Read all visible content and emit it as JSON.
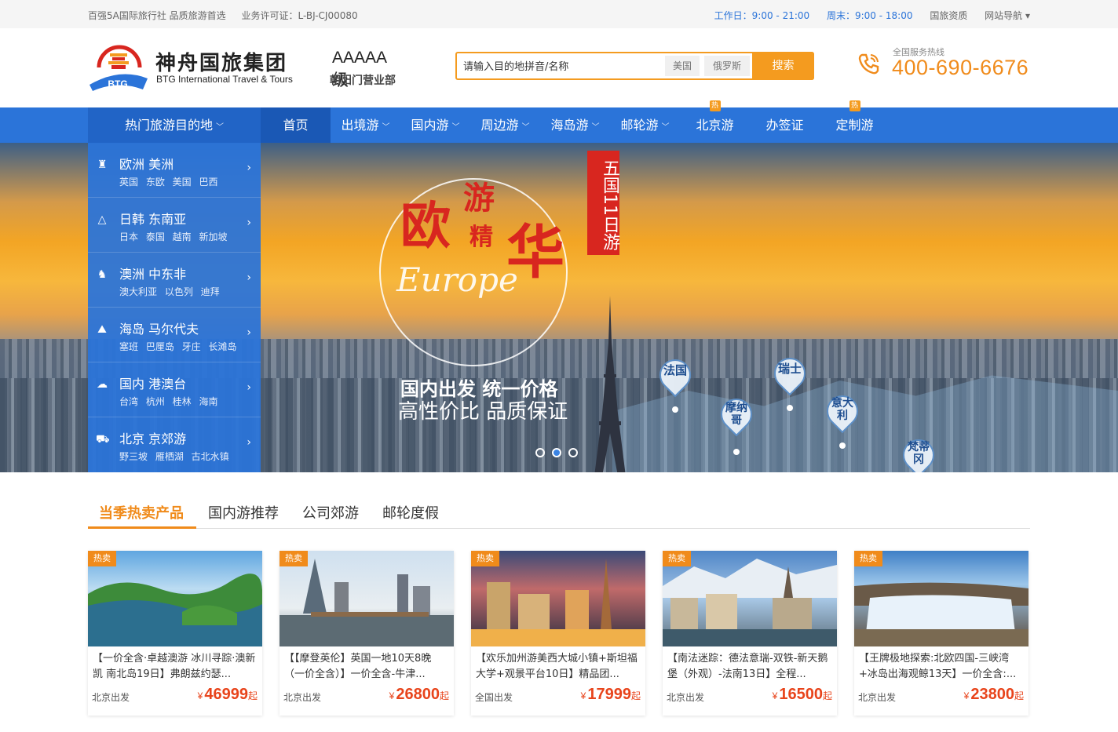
{
  "topbar": {
    "slogan": "百强5A国际旅行社 品质旅游首选",
    "license": "业务许可证：L-BJ-CJ00080",
    "workday": "工作日：9:00 - 21:00",
    "weekend": "周末：9:00 - 18:00",
    "qualification": "国旅资质",
    "sitenav": "网站导航 ▾"
  },
  "logo": {
    "name_cn": "神舟国旅集团",
    "name_en": "BTG International Travel & Tours",
    "level": "AAAAA级",
    "branch": "朝阳门营业部",
    "mark_text": "BTG"
  },
  "search": {
    "placeholder": "请输入目的地拼音/名称",
    "tags": [
      "美国",
      "俄罗斯"
    ],
    "button": "搜索"
  },
  "hotline": {
    "label": "全国服务热线",
    "number": "400-690-6676"
  },
  "nav": {
    "destinations": "热门旅游目的地",
    "items": [
      {
        "label": "首页"
      },
      {
        "label": "出境游"
      },
      {
        "label": "国内游"
      },
      {
        "label": "周边游"
      },
      {
        "label": "海岛游"
      },
      {
        "label": "邮轮游"
      },
      {
        "label": "北京游"
      },
      {
        "label": "办签证"
      },
      {
        "label": "定制游"
      }
    ],
    "hot_badge": "热"
  },
  "side_menu": [
    {
      "title": "欧洲  美洲",
      "subs": "英国 东欧 美国 巴西",
      "icon": "tower-icon"
    },
    {
      "title": "日韩  东南亚",
      "subs": "日本 泰国 越南 新加坡",
      "icon": "mountain-icon"
    },
    {
      "title": "澳洲  中东非",
      "subs": "澳大利亚 以色列 迪拜",
      "icon": "camel-icon"
    },
    {
      "title": "海岛  马尔代夫",
      "subs": "塞班 巴厘岛 牙庄 长滩岛",
      "icon": "island-icon"
    },
    {
      "title": "国内  港澳台",
      "subs": "台湾 杭州 桂林 海南",
      "icon": "china-map-icon"
    },
    {
      "title": "北京  京郊游",
      "subs": "野三坡 雁栖湖 古北水镇",
      "icon": "car-icon"
    }
  ],
  "banner": {
    "chars": [
      "欧",
      "游",
      "精",
      "华"
    ],
    "script": "Europe",
    "vertical_tag": "五国11日游",
    "slogan1": "国内出发 统一价格",
    "slogan2": "高性价比 品质保证",
    "pins": [
      "法国",
      "摩纳哥",
      "瑞士",
      "意大利",
      "梵蒂冈"
    ]
  },
  "tabs": [
    "当季热卖产品",
    "国内游推荐",
    "公司郊游",
    "邮轮度假"
  ],
  "products": [
    {
      "badge": "热卖",
      "title": "【一价全含·卓越澳游 冰川寻踪·澳新凯 南北岛19日】弗朗兹约瑟...",
      "from": "北京出发",
      "currency": "¥",
      "price": "46999",
      "suffix": "起"
    },
    {
      "badge": "热卖",
      "title": "【【摩登英伦】英国一地10天8晚（一价全含）】一价全含-牛津...",
      "from": "北京出发",
      "currency": "¥",
      "price": "26800",
      "suffix": "起"
    },
    {
      "badge": "热卖",
      "title": "【欢乐加州游美西大城小镇+斯坦福大学+观景平台10日】精品团...",
      "from": "全国出发",
      "currency": "¥",
      "price": "17999",
      "suffix": "起"
    },
    {
      "badge": "热卖",
      "title": "【南法迷踪：德法意瑞-双铁-新天鹅堡（外观）-法南13日】全程...",
      "from": "北京出发",
      "currency": "¥",
      "price": "16500",
      "suffix": "起"
    },
    {
      "badge": "热卖",
      "title": "【王牌极地探索:北欧四国-三峡湾+冰岛出海观鲸13天】一价全含:...",
      "from": "北京出发",
      "currency": "¥",
      "price": "23800",
      "suffix": "起"
    }
  ],
  "colors": {
    "primary": "#2b74d9",
    "accent": "#f08b1b",
    "price": "#e8441b",
    "banner_red": "#d8261f"
  }
}
